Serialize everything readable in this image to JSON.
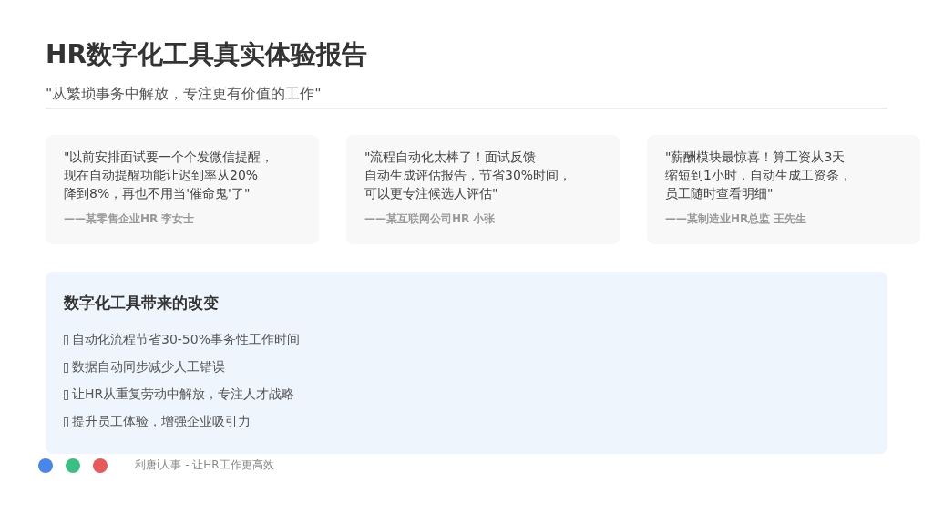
{
  "title": "HR数字化工具真实体验报告",
  "subtitle": "\"从繁琐事务中解放，专注更有价值的工作\"",
  "testimonials": [
    {
      "lines": [
        "\"以前安排面试要一个个发微信提醒，",
        "现在自动提醒功能让迟到率从20%",
        "降到8%，再也不用当'催命鬼'了\""
      ],
      "author": "——某零售企业HR 李女士"
    },
    {
      "lines": [
        "\"流程自动化太棒了！面试反馈",
        "自动生成评估报告，节省30%时间，",
        "可以更专注候选人评估\""
      ],
      "author": "——某互联网公司HR 小张"
    },
    {
      "lines": [
        "\"薪酬模块最惊喜！算工资从3天",
        "缩短到1小时，自动生成工资条，",
        "员工随时查看明细\""
      ],
      "author": "——某制造业HR总监 王先生"
    }
  ],
  "changes": {
    "heading": "数字化工具带来的改变",
    "items": [
      "自动化流程节省30-50%事务性工作时间",
      "数据自动同步减少人工错误",
      "让HR从重复劳动中解放，专注人才战略",
      "提升员工体验，增强企业吸引力"
    ]
  },
  "footer": {
    "dots": [
      {
        "color": "#4a86e8"
      },
      {
        "color": "#3dbf83"
      },
      {
        "color": "#e55a5a"
      }
    ],
    "text": "利唐i人事 - 让HR工作更高效"
  }
}
